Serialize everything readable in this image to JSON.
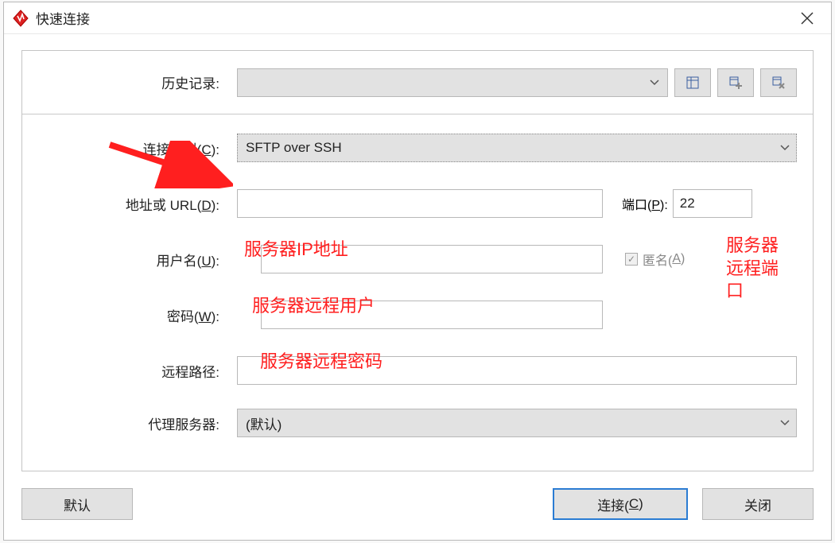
{
  "window": {
    "title": "快速连接"
  },
  "labels": {
    "history": "历史记录:",
    "conn_type_prefix": "连接类型(",
    "conn_type_key": "C",
    "address_prefix": "地址或 URL(",
    "address_key": "D",
    "username_prefix": "用户名(",
    "username_key": "U",
    "password_prefix": "密码(",
    "password_key": "W",
    "remote_path": "远程路径:",
    "proxy": "代理服务器:",
    "port_prefix": "端口(",
    "port_key": "P",
    "anon_prefix": "匿名(",
    "anon_key": "A",
    "close_paren": "):",
    "close_paren_nosuffix": ")"
  },
  "values": {
    "conn_type": "SFTP over SSH",
    "port": "22",
    "proxy": "(默认)",
    "address": "",
    "username": "",
    "password": "",
    "remote_path": ""
  },
  "buttons": {
    "default": "默认",
    "connect_prefix": "连接(",
    "connect_key": "C",
    "close": "关闭"
  },
  "annotations": {
    "address": "服务器IP地址",
    "username": "服务器远程用户",
    "password": "服务器远程密码",
    "port": "服务器远程端口"
  },
  "icons": {
    "history_edit": "table-columns-icon",
    "history_add": "table-add-icon",
    "history_del": "table-delete-icon"
  }
}
